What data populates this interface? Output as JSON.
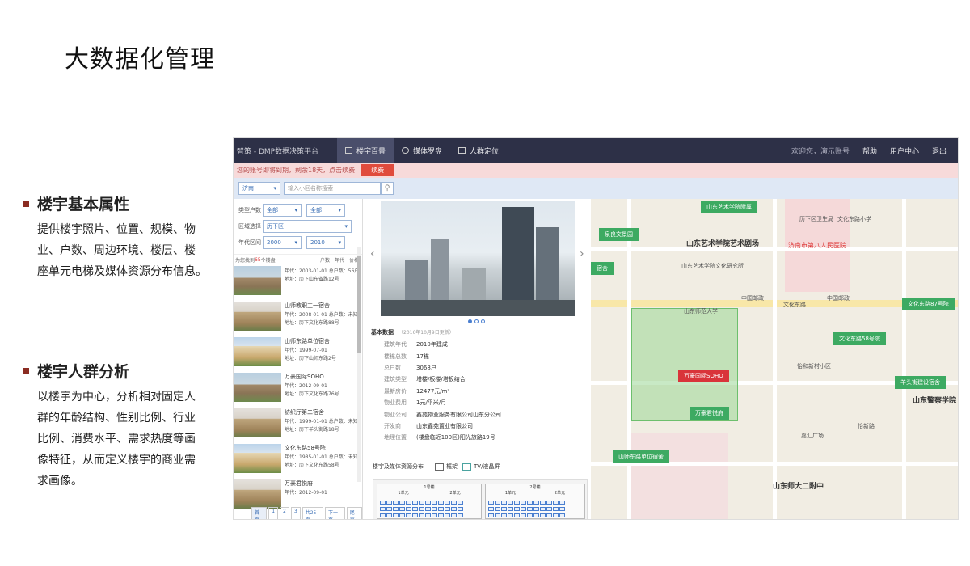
{
  "slide": {
    "title": "大数据化管理",
    "sections": [
      {
        "heading": "楼宇基本属性",
        "body": "提供楼宇照片、位置、规模、物 业、户数、周边环境、楼层、楼 座单元电梯及媒体资源分布信息。"
      },
      {
        "heading": "楼宇人群分析",
        "body": "以楼宇为中心，分析相对固定人 群的年龄结构、性别比例、行业 比例、消费水平、需求热度等画 像特征，从而定义楼宇的商业需 求画像。"
      }
    ]
  },
  "app": {
    "brand": "智策 - DMP数据决策平台",
    "tabs": [
      {
        "label": "楼宇百景",
        "active": true
      },
      {
        "label": "媒体罗盘",
        "active": false
      },
      {
        "label": "人群定位",
        "active": false
      }
    ],
    "user": {
      "welcome": "欢迎您，演示账号",
      "help": "帮助",
      "center": "用户中心",
      "logout": "退出"
    },
    "notice": {
      "text": "您的账号即将到期，剩余18天，点击续费",
      "button": "续费"
    },
    "search": {
      "city": "济南",
      "placeholder": "输入小区名称搜索"
    },
    "filters": {
      "type_label": "类型户数",
      "type_value": "全部",
      "type_value2": "全部",
      "area_label": "区域选择",
      "area_value": "历下区",
      "year_label": "年代区间",
      "year_from": "2000",
      "year_to": "2010"
    },
    "list_header": {
      "prefix": "为您找到",
      "count": "65",
      "suffix": "个楼盘",
      "sort1": "户数",
      "sort2": "年代",
      "sort3": "价格"
    },
    "list": [
      {
        "name": "",
        "l1": "年代：2003-01-01 总户数：56户",
        "l2": "地址：历下山东省路12号"
      },
      {
        "name": "山师教职工一宿舍",
        "l1": "年代：2008-01-01 总户数：未知",
        "l2": "地址：历下文化东路88号"
      },
      {
        "name": "山师东路单位宿舍",
        "l1": "年代：1999-07-01",
        "l2": "地址：历下山师东路2号"
      },
      {
        "name": "万豪国际SOHO",
        "l1": "年代：2012-09-01",
        "l2": "地址：历下文化东路76号"
      },
      {
        "name": "纺织厅第二宿舍",
        "l1": "年代：1999-01-01 总户数：未知",
        "l2": "地址：历下羊头街路18号"
      },
      {
        "name": "文化东路58号院",
        "l1": "年代：1985-01-01 总户数：未知",
        "l2": "地址：历下文化东路58号"
      },
      {
        "name": "万豪君悦府",
        "l1": "年代：2012-09-01",
        "l2": ""
      }
    ],
    "pager": [
      "首页",
      "1",
      "2",
      "3",
      "共25页",
      "下一页",
      "尾页"
    ],
    "basic": {
      "title": "基本数据",
      "updated": "（2016年10月9日更新）",
      "rows": [
        {
          "k": "建筑年代",
          "v": "2010年建成"
        },
        {
          "k": "楼栋总数",
          "v": "17栋"
        },
        {
          "k": "总户数",
          "v": "3068户"
        },
        {
          "k": "建筑类型",
          "v": "塔楼/板楼/塔板结合"
        },
        {
          "k": "最新房价",
          "v": "12477元/m²"
        },
        {
          "k": "物业费用",
          "v": "1元/平米/月"
        },
        {
          "k": "物业公司",
          "v": "鑫苑物业服务有限公司山东分公司"
        },
        {
          "k": "开发商",
          "v": "山东鑫苑置业有限公司"
        },
        {
          "k": "地理位置",
          "v": "(楼盘临近100区)阳光旅路19号"
        }
      ]
    },
    "distribution": {
      "title": "楼宇及媒体资源分布",
      "legend1": "框架",
      "legend2": "TV/液晶屏"
    },
    "grid": {
      "b1": "1号楼",
      "b2": "2号楼",
      "u1": "1单元",
      "u2": "2单元",
      "u3": "1单元",
      "u4": "2单元"
    },
    "map": {
      "pins": [
        "山东艺术学院附属",
        "泉良文景园",
        "文化东路87号院",
        "文化东路58号院",
        "万豪国际SOHO",
        "羊头街建设宿舍",
        "万豪君悦府",
        "山师东路单位宿舍",
        "宿舍"
      ],
      "labels": [
        "山东艺术学院艺术剧场",
        "济南市第八人民医院",
        "文化东路",
        "山东警察学院",
        "山东师大二附中",
        "中国邮政",
        "历下区卫生局",
        "文化东路小学",
        "怡和新村小区",
        "山东艺术学院文化研究所",
        "中国邮政",
        "嘉汇广场",
        "怡新路",
        "山东师范大学"
      ]
    }
  }
}
